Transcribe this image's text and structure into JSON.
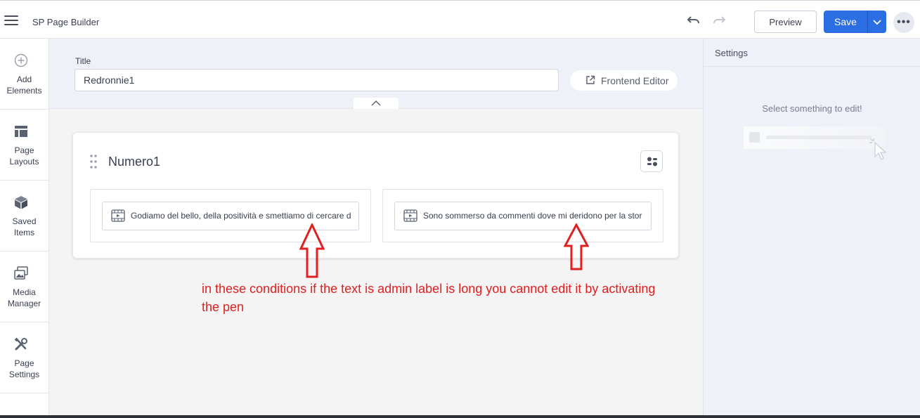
{
  "app": {
    "title": "SP Page Builder"
  },
  "toolbar": {
    "preview_label": "Preview",
    "save_label": "Save"
  },
  "sidebar": {
    "items": [
      {
        "label": "Add\nElements",
        "icon": "plus-circle-icon"
      },
      {
        "label": "Page\nLayouts",
        "icon": "layout-icon"
      },
      {
        "label": "Saved\nItems",
        "icon": "cube-icon"
      },
      {
        "label": "Media\nManager",
        "icon": "image-gallery-icon"
      },
      {
        "label": "Page\nSettings",
        "icon": "tools-icon"
      }
    ]
  },
  "page": {
    "title_label": "Title",
    "title_value": "Redronnie1",
    "frontend_editor_label": "Frontend Editor"
  },
  "section": {
    "title": "Numero1",
    "columns": [
      {
        "addon_label": "Godiamo del bello, della positività e smettiamo di cercare d"
      },
      {
        "addon_label": "Sono sommerso da commenti dove mi deridono per la stor"
      }
    ]
  },
  "annotation": {
    "text": "in these conditions if the text is admin label is long you cannot edit it by activating the pen",
    "color": "#e02020"
  },
  "settings": {
    "title": "Settings",
    "empty_message": "Select something to edit!"
  },
  "colors": {
    "accent": "#2b6de3"
  }
}
